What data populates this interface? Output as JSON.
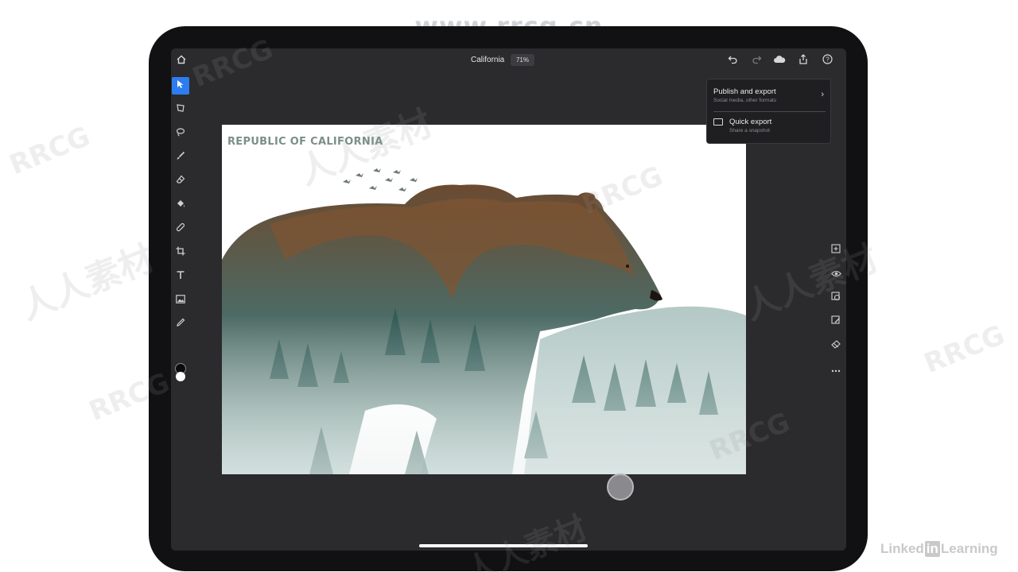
{
  "watermark": {
    "top_url": "www.rrcg.cn",
    "brand": "RRCG",
    "cjk": "人人素材"
  },
  "header": {
    "doc_title": "California",
    "zoom": "71%"
  },
  "topbar_icons": [
    "home-icon",
    "undo-icon",
    "redo-icon",
    "cloud-icon",
    "share-icon",
    "help-icon"
  ],
  "toolbar": {
    "tools": [
      {
        "name": "select-tool",
        "glyph": "➤",
        "active": true
      },
      {
        "name": "transform-tool",
        "glyph": "⬠",
        "active": false
      },
      {
        "name": "lasso-tool",
        "glyph": "◌",
        "active": false
      },
      {
        "name": "brush-tool",
        "glyph": "/",
        "active": false
      },
      {
        "name": "eraser-tool",
        "glyph": "⌫",
        "active": false
      },
      {
        "name": "fill-tool",
        "glyph": "◧",
        "active": false
      },
      {
        "name": "healing-tool",
        "glyph": "✎",
        "active": false
      },
      {
        "name": "crop-tool",
        "glyph": "⌗",
        "active": false
      },
      {
        "name": "type-tool",
        "glyph": "T",
        "active": false
      },
      {
        "name": "image-tool",
        "glyph": "▣",
        "active": false
      },
      {
        "name": "eyedropper-tool",
        "glyph": "⚲",
        "active": false
      }
    ],
    "foreground_color": "#0a0a0f",
    "background_color": "#ffffff"
  },
  "rightbar_icons": [
    "add-layer-icon",
    "visibility-icon",
    "layer-mask-icon",
    "adjustment-icon",
    "clip-icon",
    "more-icon"
  ],
  "canvas": {
    "title": "REPUBLIC OF CALIFORNIA"
  },
  "export_menu": {
    "publish_title": "Publish and export",
    "publish_sub": "Social media, other formats",
    "quick_title": "Quick export",
    "quick_sub": "Share a snapshot"
  },
  "footer": {
    "linkedin_pre": "Linked",
    "linkedin_in": "in",
    "linkedin_post": "Learning"
  }
}
